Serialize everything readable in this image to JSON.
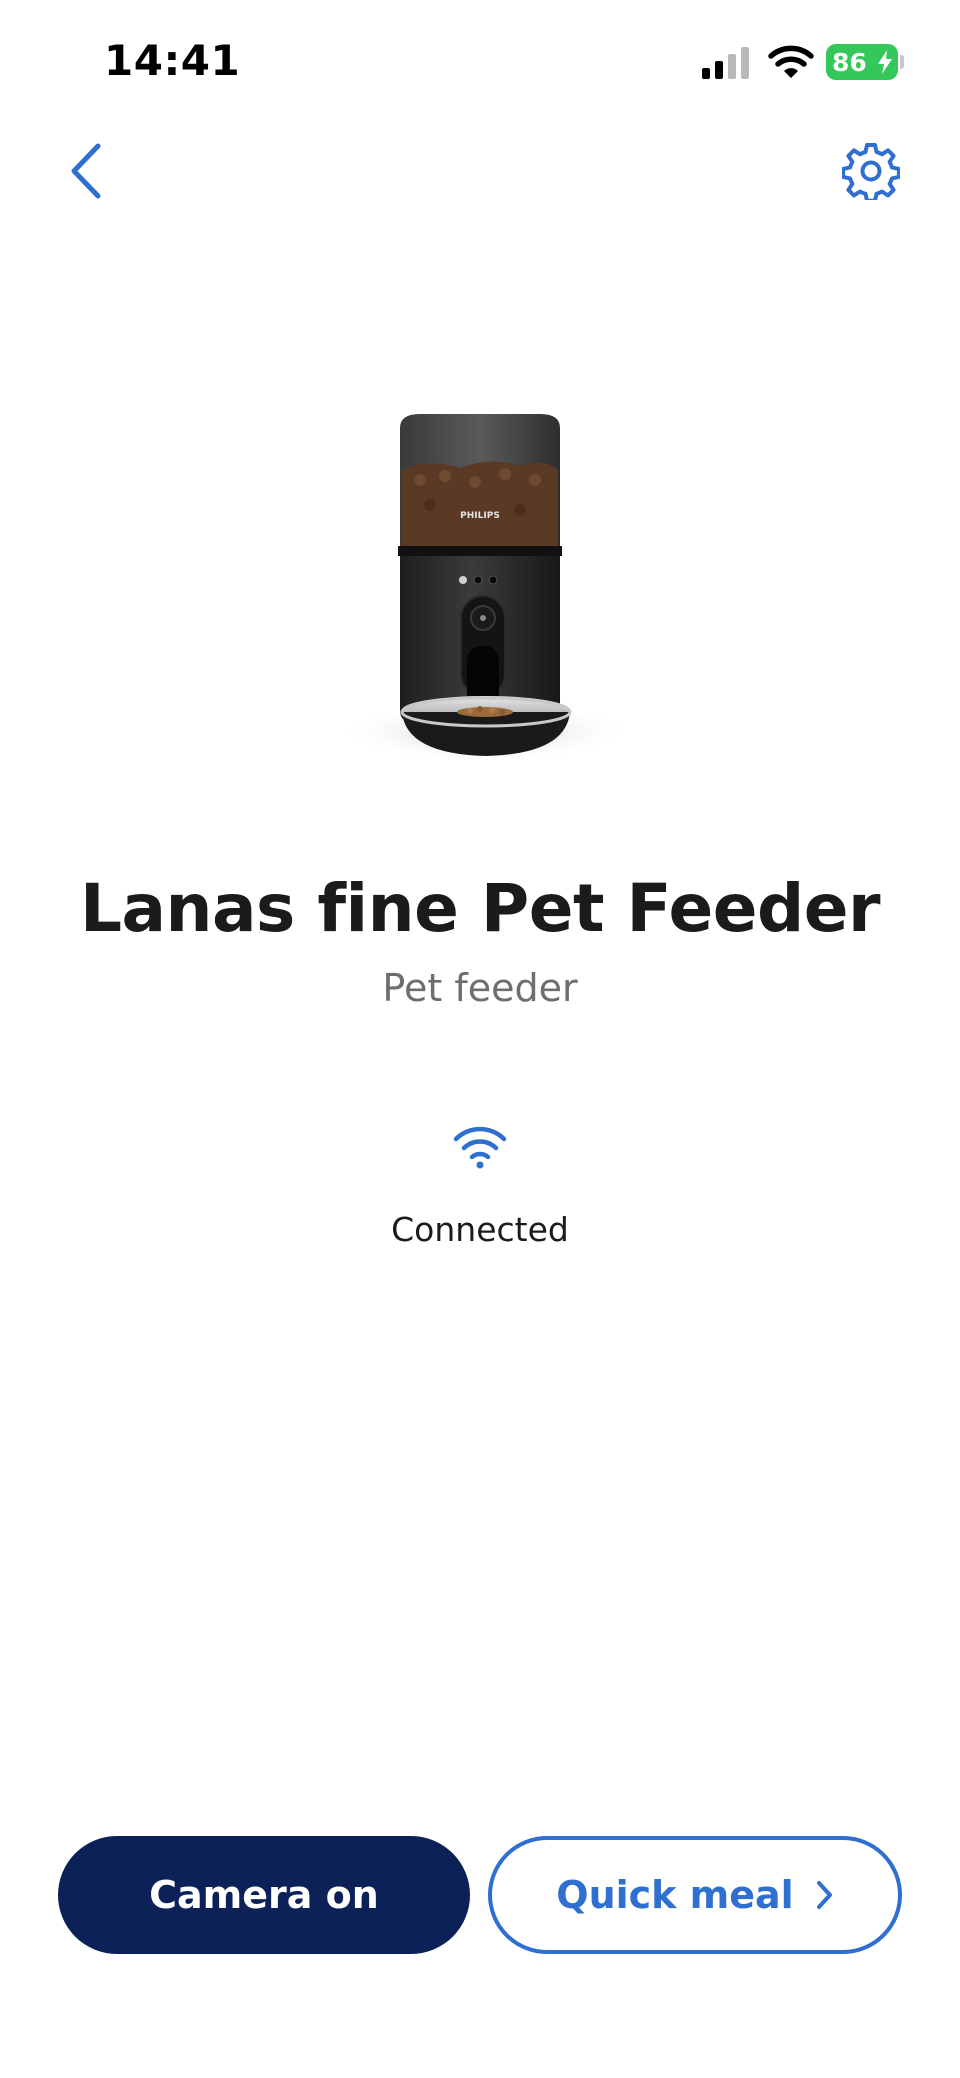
{
  "status_bar": {
    "time": "14:41",
    "battery": "86"
  },
  "nav": {
    "back_icon": "chevron-left-icon",
    "settings_icon": "gear-icon"
  },
  "device": {
    "image_brand": "PHILIPS",
    "name": "Lanas fine Pet Feeder",
    "type": "Pet feeder"
  },
  "connection": {
    "icon": "wifi-icon",
    "status": "Connected"
  },
  "actions": {
    "camera_label": "Camera on",
    "quick_meal_label": "Quick meal"
  },
  "colors": {
    "accent": "#2f6fd0",
    "primary_button": "#0b2157",
    "battery": "#34c759",
    "title": "#1b1b1b",
    "subtitle": "#6e6e6e"
  }
}
